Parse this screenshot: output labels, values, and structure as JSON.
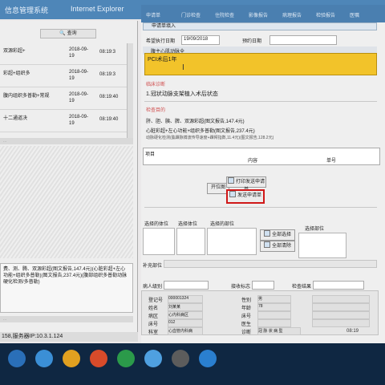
{
  "window": {
    "title_left": "信息管理系统",
    "title_right": "Internet Explorer",
    "tabs": [
      "申请单",
      "门诊检查",
      "住院检查",
      "影像报告",
      "病理报告",
      "检验报告",
      "医嘱"
    ]
  },
  "left": {
    "search_label": "查询",
    "items": [
      {
        "title": "双源彩超+",
        "date": "2018-09-19",
        "time": "08:19:3"
      },
      {
        "title": "彩超+组织多",
        "date": "2018-09-19",
        "time": "08:19:3"
      },
      {
        "title": "腹内组织多普勒+常规",
        "date": "2018-09-19",
        "time": "08:19:40"
      },
      {
        "title": "十二通道决",
        "date": "2018-09-19",
        "time": "08:19:40"
      }
    ],
    "status1": "...",
    "note": "费、测、腾、双源彩超(图文报告,147.4元)(心脏彩超+左心功能+组织多普勒)(图文报告,237.4元)(腹部组织多普勒动脉硬化检测/多普勒)",
    "status2": "...",
    "bottom": "158,服务器IP:10.3.1.124"
  },
  "right": {
    "form_header": "申请单填入",
    "date_label": "希望执行日期",
    "date_value": "19/09/2018",
    "appt_label": "预约日期",
    "sub_label": "腹主心肌动脉全",
    "diag_text": "PCI术后1年",
    "sec1_label": "临床诊断",
    "sec1_text": "1.冠状动脉支架植入术后状态",
    "sec2_label": "检查目的",
    "sec2_line1": "肝、胆、胰、脾、双源彩超(图文报告,147.4元)",
    "sec2_line2": "心脏彩超+左心功能+组织多普勒(图文报告,237.4元)",
    "sec2_line3": "动脉硬化检测(肱踝脉搏波传导速度+踝臂指数,11.4元)(图文报告,128.2元)",
    "grid_h1": "项目",
    "grid_h2": "内容",
    "grid_h3": "单号",
    "btn_open": "开位图",
    "btn_print": "打印发送申请单",
    "btn_send": "发送申请单",
    "cols": {
      "c1": "选择的体位",
      "c2": "选择体位",
      "c3": "选择的部位",
      "c4": "选择部位"
    },
    "btn_select_all": "全部选择",
    "btn_clear_all": "全部清除",
    "sig_label": "补充部位",
    "req_label": "病人级别",
    "resp_label": "接收标志",
    "reply_label": "检查结果",
    "patient": {
      "id_label": "登记号",
      "id_value": "000001324",
      "name_label": "姓名",
      "name_value": "刘某某",
      "ward_label": "病区",
      "ward_value": "心内科病区",
      "room_label": "床号",
      "room_value": "012",
      "dept_label": "科室",
      "dept_value": "心血管内科病",
      "diag_label": "诊断",
      "diag_value": "冠 脉 状 病 型"
    },
    "extra": {
      "sex_label": "性别",
      "sex_value": "男",
      "age_label": "年龄",
      "age_value": "78",
      "bed_label": "床号",
      "bed_value": "",
      "doc_label": "医生",
      "doc_value": ""
    }
  },
  "taskbar": {
    "clock": "08:19"
  }
}
